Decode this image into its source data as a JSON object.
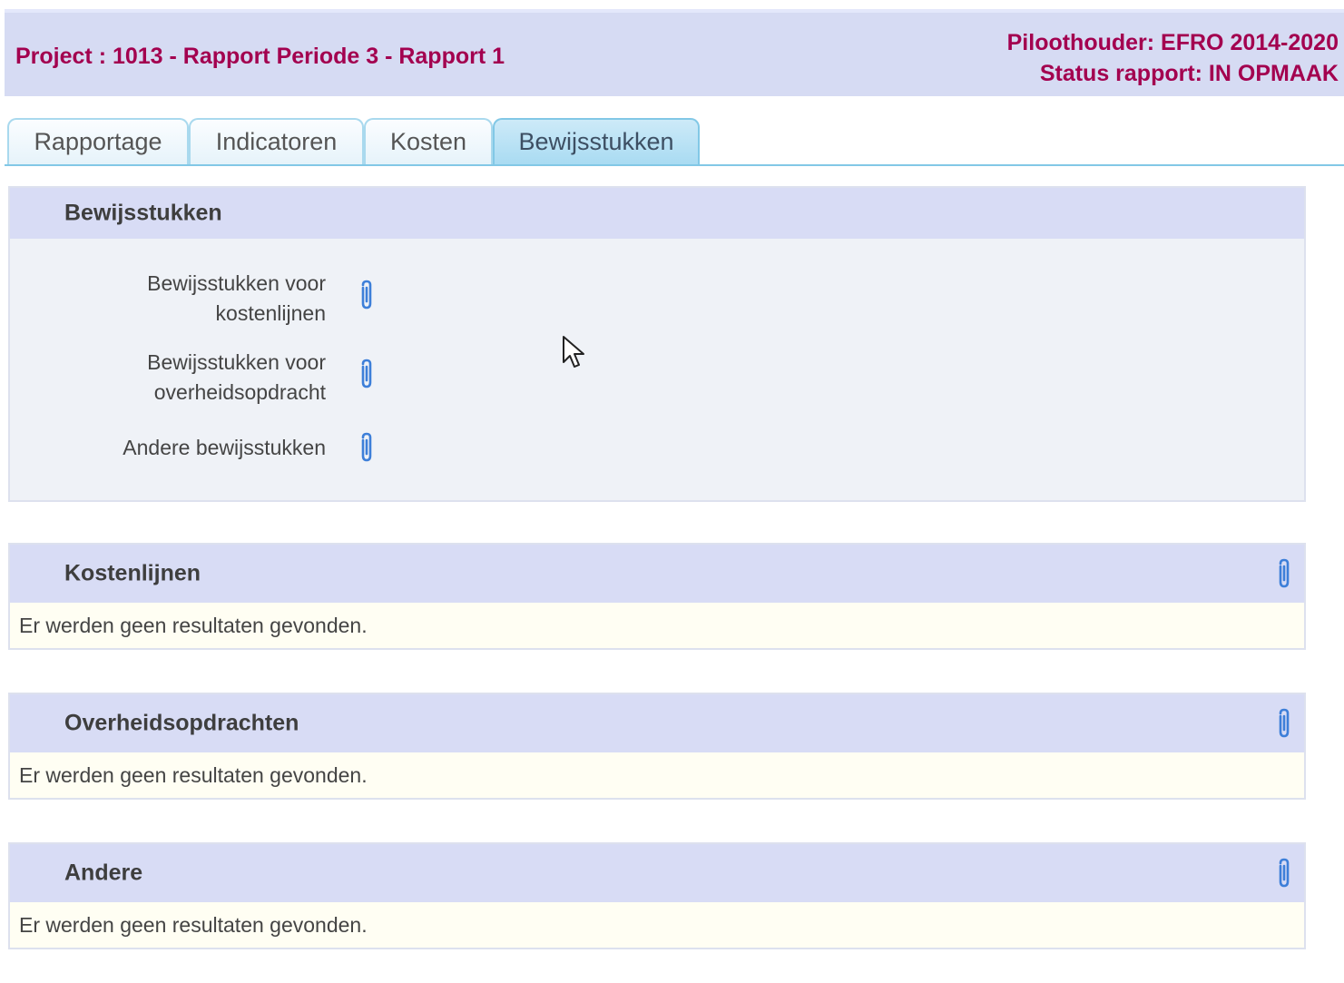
{
  "header": {
    "project_title": "Project : 1013 - Rapport Periode 3 - Rapport 1",
    "piloothouder": "Piloothouder: EFRO 2014-2020",
    "status": "Status rapport: IN OPMAAK"
  },
  "tabs": [
    {
      "label": "Rapportage",
      "active": false
    },
    {
      "label": "Indicatoren",
      "active": false
    },
    {
      "label": "Kosten",
      "active": false
    },
    {
      "label": "Bewijsstukken",
      "active": true
    }
  ],
  "bewijsstukken": {
    "title": "Bewijsstukken",
    "items": [
      {
        "label_line1": "Bewijsstukken voor",
        "label_line2": "kostenlijnen",
        "icon": "paperclip-icon"
      },
      {
        "label_line1": "Bewijsstukken voor",
        "label_line2": "overheidsopdracht",
        "icon": "paperclip-icon"
      },
      {
        "label_line1": "Andere bewijsstukken",
        "icon": "paperclip-icon"
      }
    ]
  },
  "sections": [
    {
      "title": "Kostenlijnen",
      "empty_text": "Er werden geen resultaten gevonden.",
      "icon": "paperclip-icon"
    },
    {
      "title": "Overheidsopdrachten",
      "empty_text": "Er werden geen resultaten gevonden.",
      "icon": "paperclip-icon"
    },
    {
      "title": "Andere",
      "empty_text": "Er werden geen resultaten gevonden.",
      "icon": "paperclip-icon"
    }
  ],
  "colors": {
    "header_bg": "#d6dbf3",
    "header_text": "#a3004f",
    "active_tab": "#a9dbf2",
    "paperclip": "#3d7fd9",
    "empty_row_bg": "#fffef3"
  }
}
